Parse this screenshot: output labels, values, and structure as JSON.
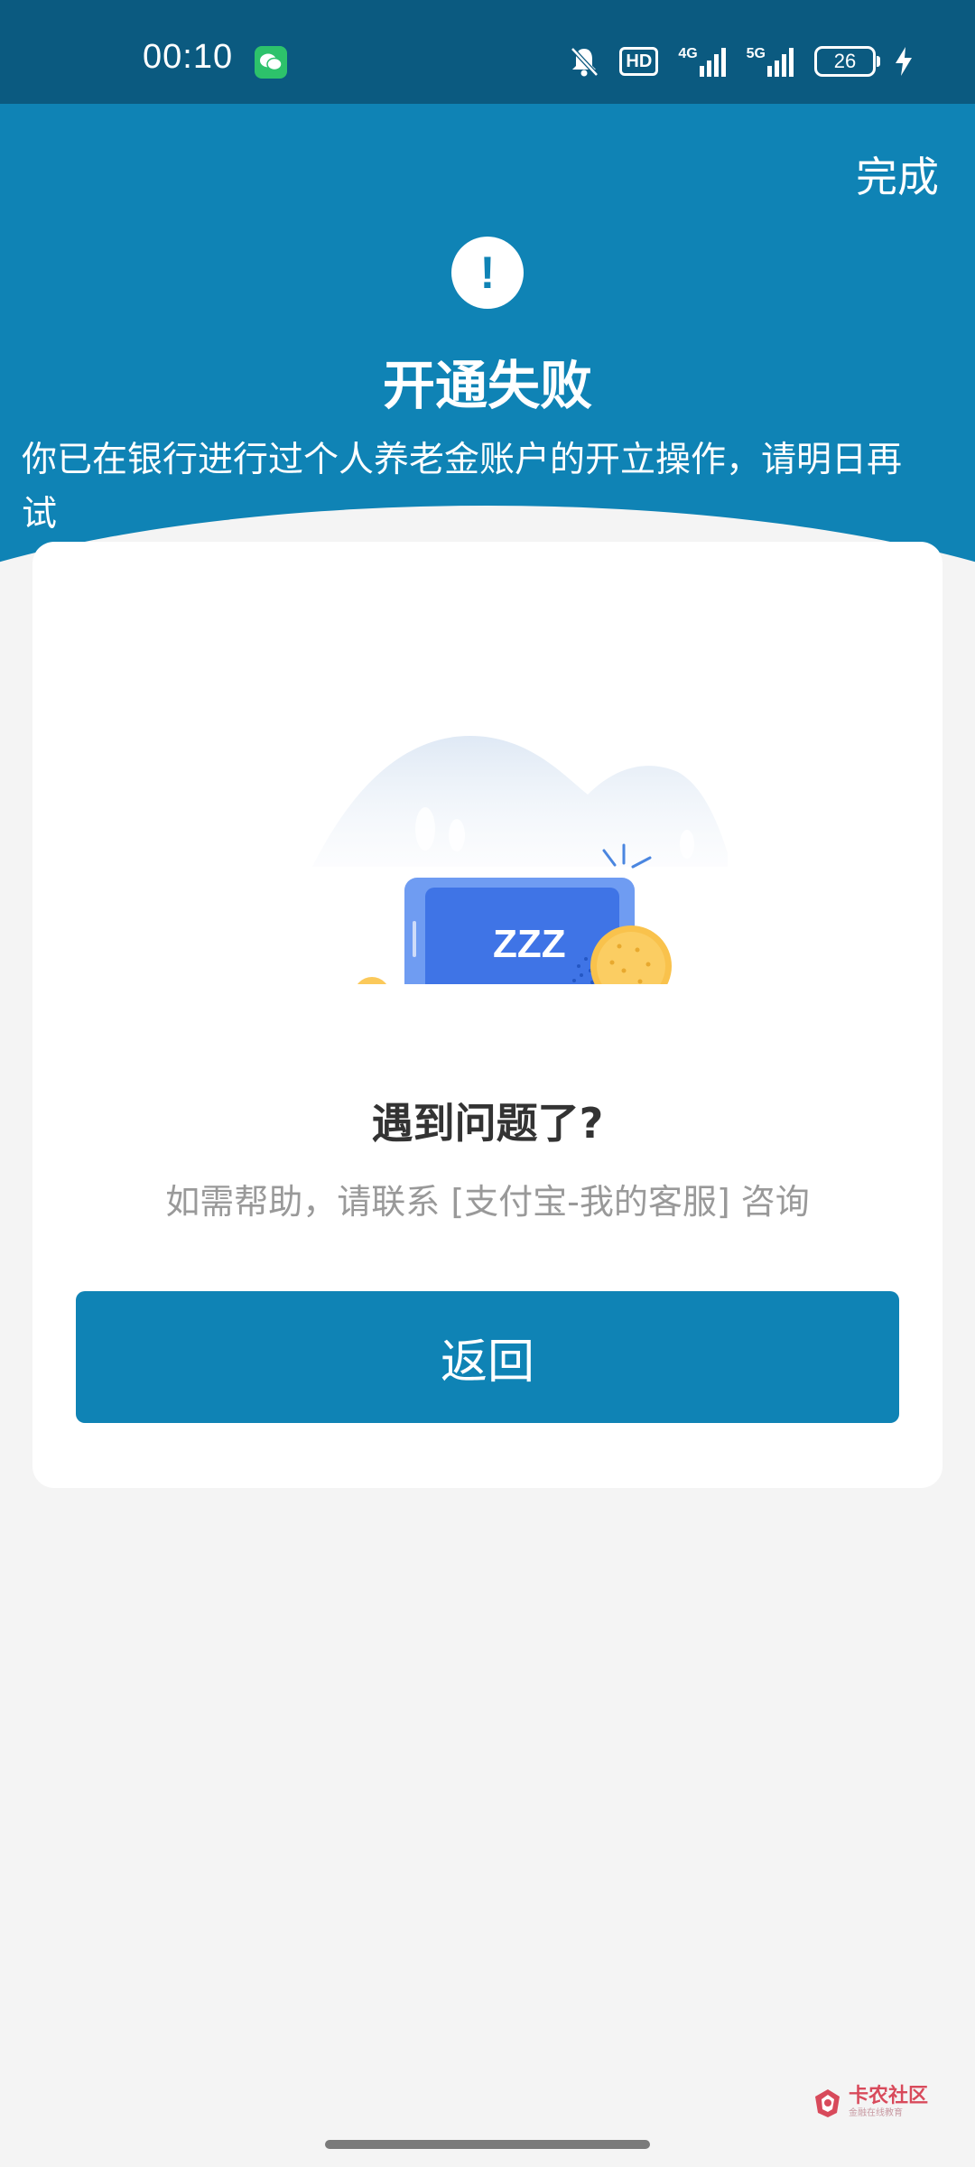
{
  "status_bar": {
    "time": "00:10",
    "hd_label": "HD",
    "net1": "4G",
    "net2": "5G",
    "battery": "26",
    "icons": [
      "wechat-icon",
      "bell-mute-icon",
      "hd-icon",
      "signal-4g-icon",
      "signal-5g-icon",
      "battery-icon",
      "charging-icon"
    ]
  },
  "header": {
    "done_label": "完成",
    "alert_symbol": "!",
    "title": "开通失败",
    "message": "你已在银行进行过个人养老金账户的开立操作，请明日再试"
  },
  "card": {
    "illustration_text": "ZZZ",
    "help_title": "遇到问题了?",
    "help_text": "如需帮助，请联系 [支付宝-我的客服] 咨询",
    "back_label": "返回"
  },
  "watermark": {
    "name": "卡农社区",
    "sub": "金融在线教育"
  },
  "colors": {
    "header_blue": "#0f83b5",
    "status_blue": "#0b5a80",
    "background": "#f4f4f4",
    "button_blue": "#0f83b5"
  }
}
